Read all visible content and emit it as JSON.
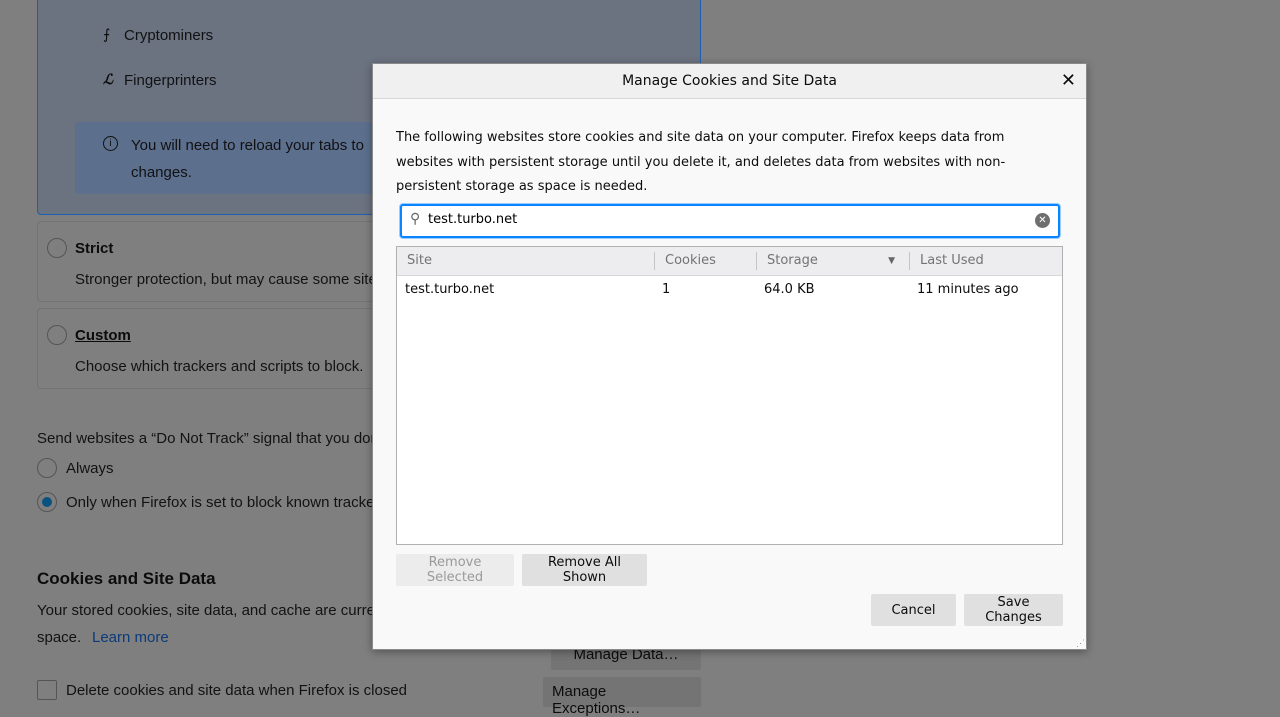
{
  "background": {
    "trackers": [
      {
        "icon": "cryptominer-icon",
        "label": "Cryptominers"
      },
      {
        "icon": "fingerprinter-icon",
        "label": "Fingerprinters"
      }
    ],
    "reload_notice": "You will need to reload your tabs to",
    "reload_notice_2": "changes.",
    "strict": {
      "label": "Strict",
      "desc": "Stronger protection, but may cause some site"
    },
    "custom": {
      "label": "Custom",
      "desc": "Choose which trackers and scripts to block."
    },
    "dnt_label": "Send websites a “Do Not Track” signal that you don",
    "dnt_always": "Always",
    "dnt_only": "Only when Firefox is set to block known tracker",
    "cookies_heading": "Cookies and Site Data",
    "cookies_desc": "Your stored cookies, site data, and cache are curren",
    "cookies_desc_2": "space.",
    "learn_more": "Learn more",
    "manage_data": "Manage Data…",
    "delete_on_close": "Delete cookies and site data when Firefox is closed",
    "manage_exceptions": "Manage Exceptions…"
  },
  "dialog": {
    "title": "Manage Cookies and Site Data",
    "description": "The following websites store cookies and site data on your computer. Firefox keeps data from websites with persistent storage until you delete it, and deletes data from websites with non-persistent storage as space is needed.",
    "search_value": "test.turbo.net",
    "columns": [
      "Site",
      "Cookies",
      "Storage",
      "Last Used"
    ],
    "sort_column": "Storage",
    "rows": [
      {
        "site": "test.turbo.net",
        "cookies": "1",
        "storage": "64.0 KB",
        "last_used": "11 minutes ago"
      }
    ],
    "remove_selected": "Remove Selected",
    "remove_all_shown": "Remove All Shown",
    "cancel": "Cancel",
    "save_changes": "Save Changes"
  },
  "colors": {
    "accent": "#0a84ff",
    "overlay": "#7f7f7f"
  }
}
